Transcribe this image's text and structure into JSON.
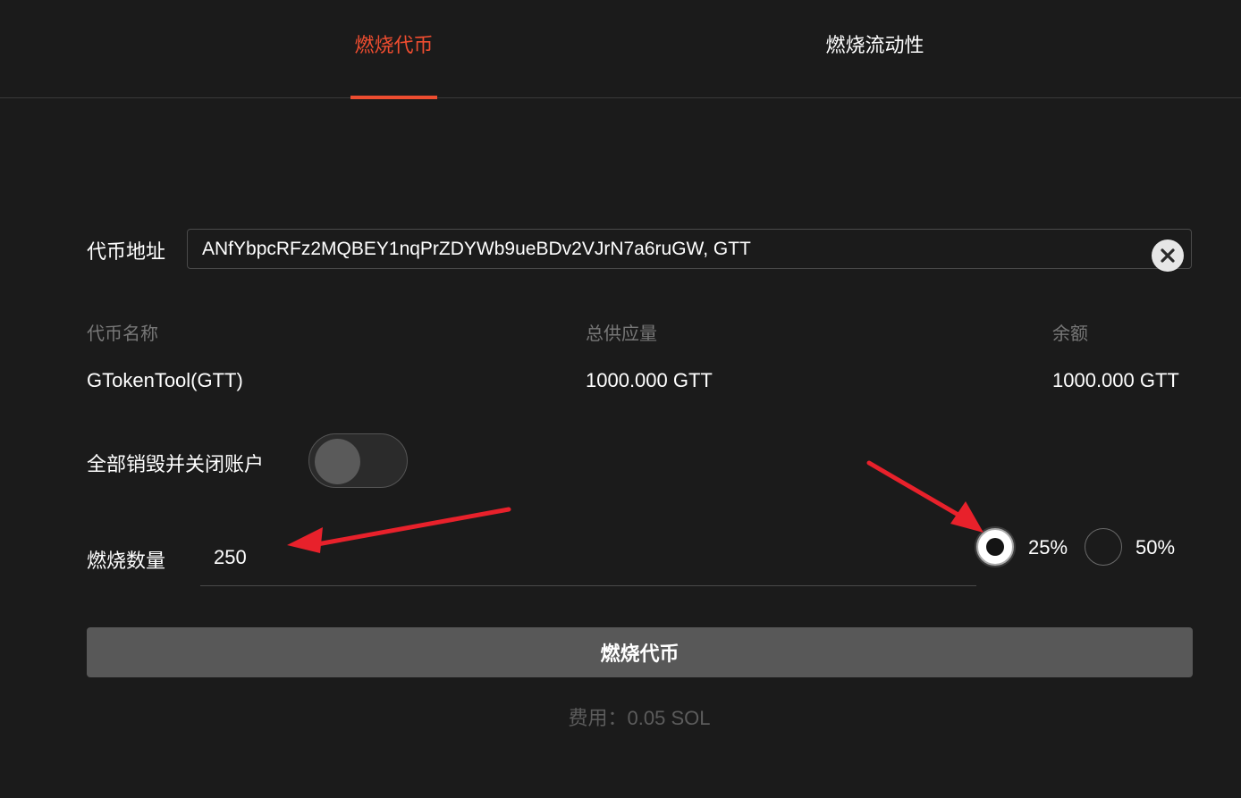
{
  "tabs": [
    {
      "label": "燃烧代币",
      "active": true
    },
    {
      "label": "燃烧流动性",
      "active": false
    }
  ],
  "address": {
    "label": "代币地址",
    "value": "ANfYbpcRFz2MQBEY1nqPrZDYWb9ueBDv2VJrN7a6ruGW, GTT",
    "clear_icon": "close-circle-icon"
  },
  "info": {
    "headers": [
      "代币名称",
      "总供应量",
      "余额"
    ],
    "values": [
      "GTokenTool(GTT)",
      "1000.000 GTT",
      "1000.000 GTT"
    ]
  },
  "close_all": {
    "label": "全部销毁并关闭账户",
    "enabled": false
  },
  "amount": {
    "label": "燃烧数量",
    "value": "250",
    "options": [
      {
        "label": "25%",
        "selected": true
      },
      {
        "label": "50%",
        "selected": false
      }
    ]
  },
  "submit": {
    "label": "燃烧代币"
  },
  "fee": {
    "text": "费用：0.05 SOL"
  },
  "colors": {
    "accent": "#ee4d30",
    "background": "#1b1b1b",
    "annotation_arrow": "#e8212b"
  }
}
